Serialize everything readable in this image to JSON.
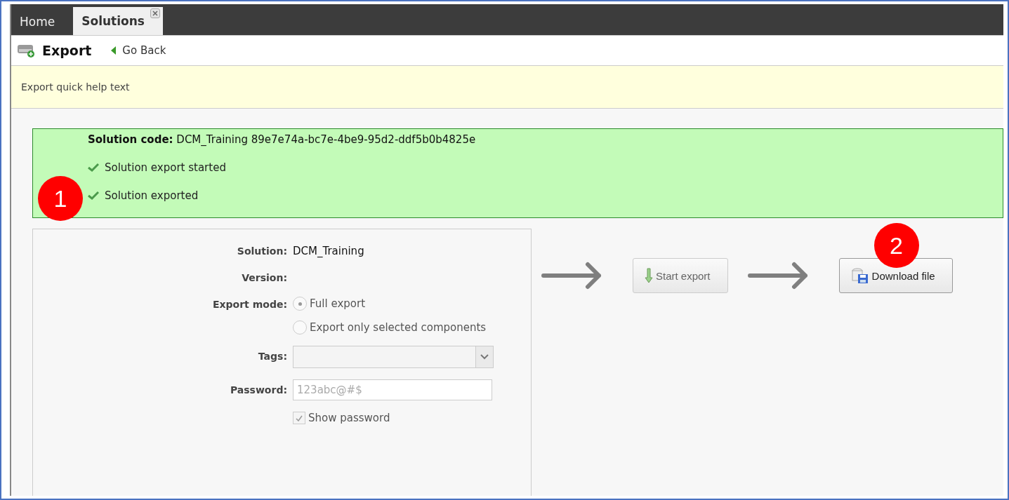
{
  "tabs": [
    {
      "label": "Home",
      "selected": false,
      "closable": false
    },
    {
      "label": "Solutions",
      "selected": true,
      "closable": true
    }
  ],
  "header": {
    "title": "Export",
    "back_link": "Go Back"
  },
  "help": {
    "text": "Export quick help text"
  },
  "status": {
    "code_label": "Solution code:",
    "code_value": "DCM_Training 89e7e74a-bc7e-4be9-95d2-ddf5b0b4825e",
    "callout": "1",
    "messages": [
      {
        "text": "Solution export started",
        "checked": true
      },
      {
        "text": "Solution exported",
        "checked": true
      }
    ]
  },
  "form": {
    "disabled": true,
    "solution": {
      "label": "Solution:",
      "value": "DCM_Training"
    },
    "version": {
      "label": "Version:"
    },
    "export_mode": {
      "label": "Export mode:",
      "options": [
        {
          "label": "Full export",
          "selected": true
        },
        {
          "label": "Export only selected components",
          "selected": false
        }
      ]
    },
    "tags": {
      "label": "Tags:"
    },
    "password": {
      "label": "Password:",
      "value": "123abc@#$"
    },
    "show_password": {
      "label": "Show password",
      "checked": true
    }
  },
  "actions": [
    {
      "kind": "start",
      "label": "Start export",
      "disabled": true
    },
    {
      "kind": "download",
      "label": "Download file",
      "disabled": false,
      "callout": "2"
    }
  ]
}
